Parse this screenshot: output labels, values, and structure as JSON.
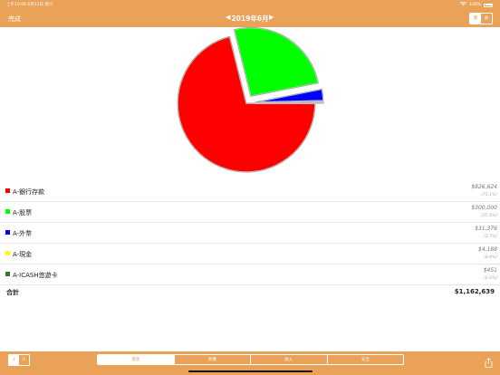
{
  "status_bar": {
    "time_date": "上午10:06   6月22日 週六",
    "battery": "100%"
  },
  "nav": {
    "done_label": "完成",
    "month_label": "2019年6月",
    "segment": [
      "圖",
      "表"
    ]
  },
  "chart_data": {
    "type": "pie",
    "title": "",
    "categories": [
      "A-銀行存款",
      "A-股票",
      "A-外幣",
      "A-現金",
      "A-ICASH悠遊卡"
    ],
    "values": [
      826624,
      300000,
      31376,
      4188,
      451
    ],
    "colors": [
      "#ff0000",
      "#00ff00",
      "#0000ff",
      "#ffff00",
      "#2f7a2f"
    ],
    "exploded": true
  },
  "legend": [
    {
      "name": "A-銀行存款",
      "amount": "$826,624",
      "percent": "(71.1%)",
      "color": "#ff0000"
    },
    {
      "name": "A-股票",
      "amount": "$300,000",
      "percent": "(25.8%)",
      "color": "#00ff00"
    },
    {
      "name": "A-外幣",
      "amount": "$31,376",
      "percent": "(2.7%)",
      "color": "#0000ff"
    },
    {
      "name": "A-現金",
      "amount": "$4,188",
      "percent": "(0.4%)",
      "color": "#ffff00"
    },
    {
      "name": "A-ICASH悠遊卡",
      "amount": "$451",
      "percent": "(0.0%)",
      "color": "#2f7a2f"
    }
  ],
  "total": {
    "label": "合計",
    "value": "$1,162,639"
  },
  "toolbar": {
    "small_segment": [
      "$",
      "U"
    ],
    "tabs": [
      "資產",
      "負債",
      "收入",
      "支出"
    ],
    "active_tab": 0
  },
  "theme": {
    "accent": "#e9a258"
  }
}
